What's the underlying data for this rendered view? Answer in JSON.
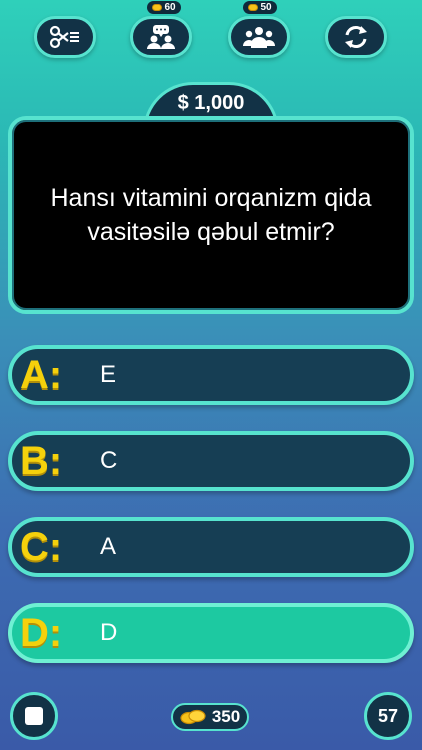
{
  "lifelines": [
    {
      "name": "fifty-fifty",
      "cost": ""
    },
    {
      "name": "ask-friend",
      "cost": "60"
    },
    {
      "name": "ask-audience",
      "cost": "50"
    },
    {
      "name": "switch-question",
      "cost": ""
    }
  ],
  "prize": "$ 1,000",
  "question": "Hansı vitamini orqanizm qida vasitəsilə qəbul etmir?",
  "answers": [
    {
      "letter": "A:",
      "text": "E"
    },
    {
      "letter": "B:",
      "text": "C"
    },
    {
      "letter": "C:",
      "text": "A"
    },
    {
      "letter": "D:",
      "text": "D"
    }
  ],
  "selected_answer": "D",
  "coins": "350",
  "timer": "57",
  "colors": {
    "accent_border": "#57e3cf",
    "selected_answer_bg": "#1dc9a1",
    "letter_yellow": "#f5d10c",
    "question_bg": "#000000"
  }
}
